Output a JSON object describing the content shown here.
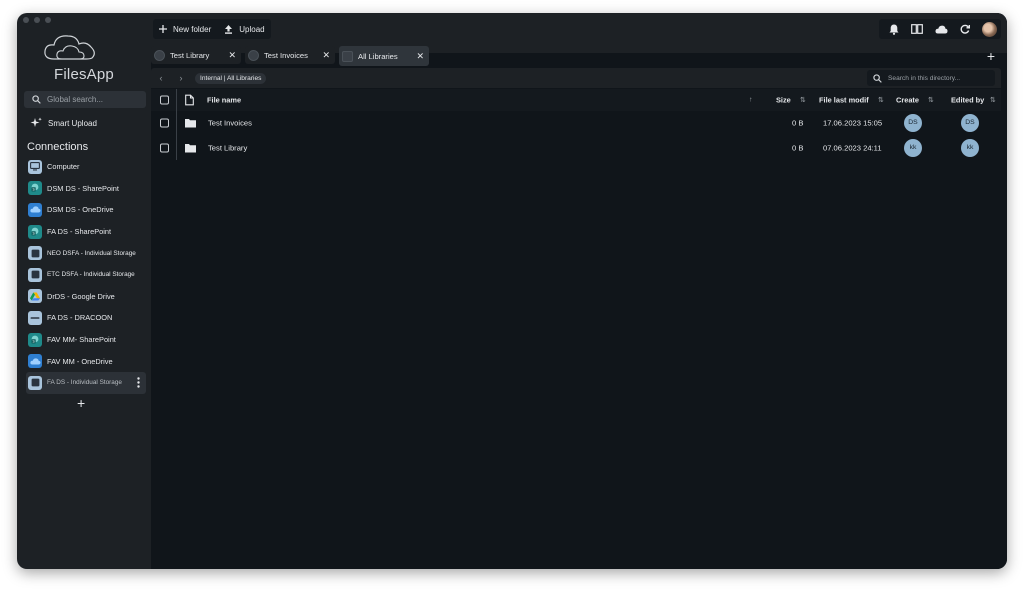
{
  "sidebar": {
    "app_name": "FilesApp",
    "search_placeholder": "Global search...",
    "smart_upload_label": "Smart Upload",
    "connections_title": "Connections",
    "connections": [
      {
        "label": "Computer",
        "type": "computer",
        "color": "#a9c4dc"
      },
      {
        "label": "DSM DS - SharePoint",
        "type": "sharepoint",
        "color": "#1f8a8a"
      },
      {
        "label": "DSM DS - OneDrive",
        "type": "onedrive",
        "color": "#2f7fd1"
      },
      {
        "label": "FA DS - SharePoint",
        "type": "sharepoint",
        "color": "#1f8a8a"
      },
      {
        "label": "NEO DSFA - Individual Storage",
        "type": "storage",
        "color": "#a9c4dc"
      },
      {
        "label": "ETC DSFA - Individual Storage",
        "type": "storage",
        "color": "#a9c4dc"
      },
      {
        "label": "DrDS - Google Drive",
        "type": "gdrive",
        "color": "#a9c4dc"
      },
      {
        "label": "FA DS - DRACOON",
        "type": "dracoon",
        "color": "#a9c4dc"
      },
      {
        "label": "FAV MM- SharePoint",
        "type": "sharepoint",
        "color": "#1f8a8a"
      },
      {
        "label": "FAV MM - OneDrive",
        "type": "onedrive",
        "color": "#2f7fd1"
      },
      {
        "label": "FA DS - Individual Storage",
        "type": "storage",
        "color": "#a9c4dc",
        "active": true
      }
    ],
    "add_label": "+"
  },
  "toolbar": {
    "new_folder_label": "New folder",
    "upload_label": "Upload"
  },
  "tabs": [
    {
      "label": "Test Library",
      "active": false
    },
    {
      "label": "Test Invoices",
      "active": false
    },
    {
      "label": "All Libraries",
      "active": true
    }
  ],
  "add_tab_label": "+",
  "path": {
    "breadcrumb": "Internal | All Libraries",
    "search_placeholder": "Search in this directory..."
  },
  "table": {
    "columns": {
      "name": "File name",
      "size": "Size",
      "modified": "File last modified",
      "created": "Created by",
      "edited": "Edited by"
    },
    "rows": [
      {
        "name": "Test Invoices",
        "size": "0 B",
        "modified": "17.06.2023 15:05",
        "created": "DS",
        "edited": "DS"
      },
      {
        "name": "Test Library",
        "size": "0 B",
        "modified": "07.06.2023 24:11",
        "created": "kk",
        "edited": "kk"
      }
    ]
  },
  "colors": {
    "window_bg": "#1d2125",
    "content_bg": "#10151a",
    "avatar_badge": "#8fb3cf"
  }
}
